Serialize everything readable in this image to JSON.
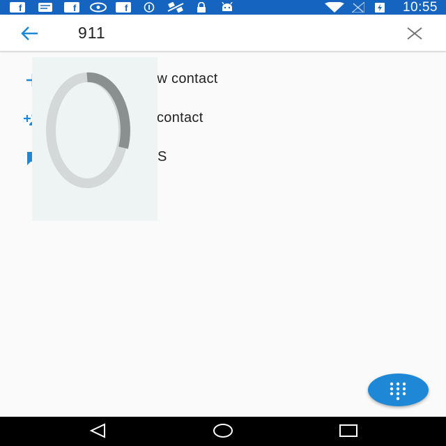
{
  "status_bar": {
    "time": "10:55",
    "left_icons": [
      "facebook-icon",
      "message-icon",
      "facebook-icon",
      "nvidia-icon",
      "facebook-icon",
      "info-icon",
      "satellite-icon",
      "lock-icon",
      "android-icon"
    ],
    "right_icons": [
      "wifi-icon",
      "no-signal-icon",
      "battery-charging-icon"
    ]
  },
  "search": {
    "query": "911",
    "back_icon": "arrow-back-icon",
    "clear_icon": "close-icon"
  },
  "menu": [
    {
      "icon": "add-icon",
      "label": "Create new contact",
      "visible_label": "ew contact"
    },
    {
      "icon": "add-person-icon",
      "label": "Add to a contact",
      "visible_label": "contact"
    },
    {
      "icon": "message-icon",
      "label": "Send SMS",
      "visible_label": "S"
    }
  ],
  "fab": {
    "icon": "dialpad-icon"
  },
  "nav_bar": {
    "icons": [
      "back-icon",
      "home-icon",
      "recents-icon"
    ]
  },
  "colors": {
    "status_bar": "#1565c0",
    "accent": "#1e88d6",
    "background": "#fafafa",
    "spinner_track": "#d4d8d8",
    "spinner_arc": "#8a9090"
  }
}
